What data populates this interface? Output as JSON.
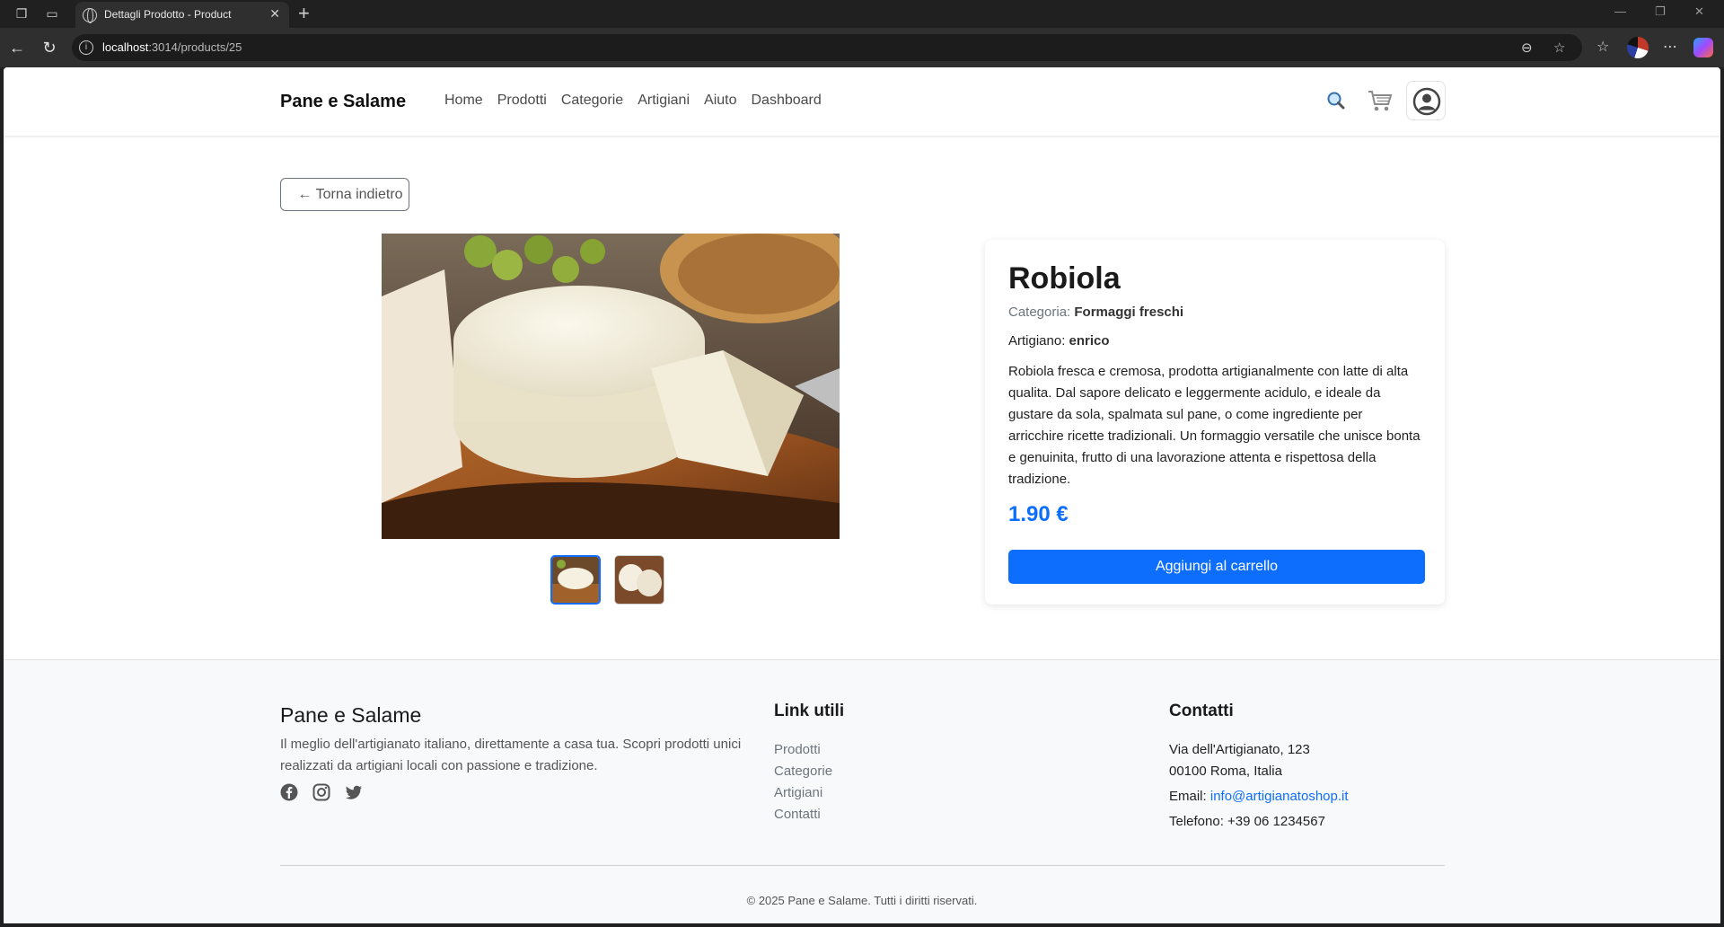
{
  "browser": {
    "tab_title": "Dettagli Prodotto - Product",
    "url_host": "localhost",
    "url_path": ":3014/products/25"
  },
  "navbar": {
    "brand": "Pane e Salame",
    "menu": [
      "Home",
      "Prodotti",
      "Categorie",
      "Artigiani",
      "Aiuto",
      "Dashboard"
    ]
  },
  "back_button": "← Torna indietro",
  "product": {
    "name": "Robiola",
    "category_label": "Categoria:",
    "category": "Formaggi freschi",
    "artisan_label": "Artigiano:",
    "artisan": "enrico",
    "description": "Robiola fresca e cremosa, prodotta artigianalmente con latte di alta qualita. Dal sapore delicato e leggermente acidulo, e ideale da gustare da sola, spalmata sul pane, o come ingrediente per arricchire ricette tradizionali. Un formaggio versatile che unisce bonta e genuinita, frutto di una lavorazione attenta e rispettosa della tradizione.",
    "price": "1.90 €",
    "add_to_cart": "Aggiungi al carrello"
  },
  "footer": {
    "brand": "Pane e Salame",
    "about": "Il meglio dell'artigianato italiano, direttamente a casa tua. Scopri prodotti unici realizzati da artigiani locali con passione e tradizione.",
    "links_title": "Link utili",
    "links": [
      "Prodotti",
      "Categorie",
      "Artigiani",
      "Contatti"
    ],
    "contact_title": "Contatti",
    "address_line1": "Via dell'Artigianato, 123",
    "address_line2": "00100 Roma, Italia",
    "email_label": "Email:",
    "email": "info@artigianatoshop.it",
    "phone": "Telefono: +39 06 1234567",
    "copyright": "© 2025 Pane e Salame. Tutti i diritti riservati."
  },
  "colors": {
    "primary": "#0d6efd",
    "browser_bg": "#202020"
  },
  "icons": [
    "search-icon",
    "cart-icon",
    "user-icon",
    "facebook-icon",
    "instagram-icon",
    "twitter-icon"
  ]
}
